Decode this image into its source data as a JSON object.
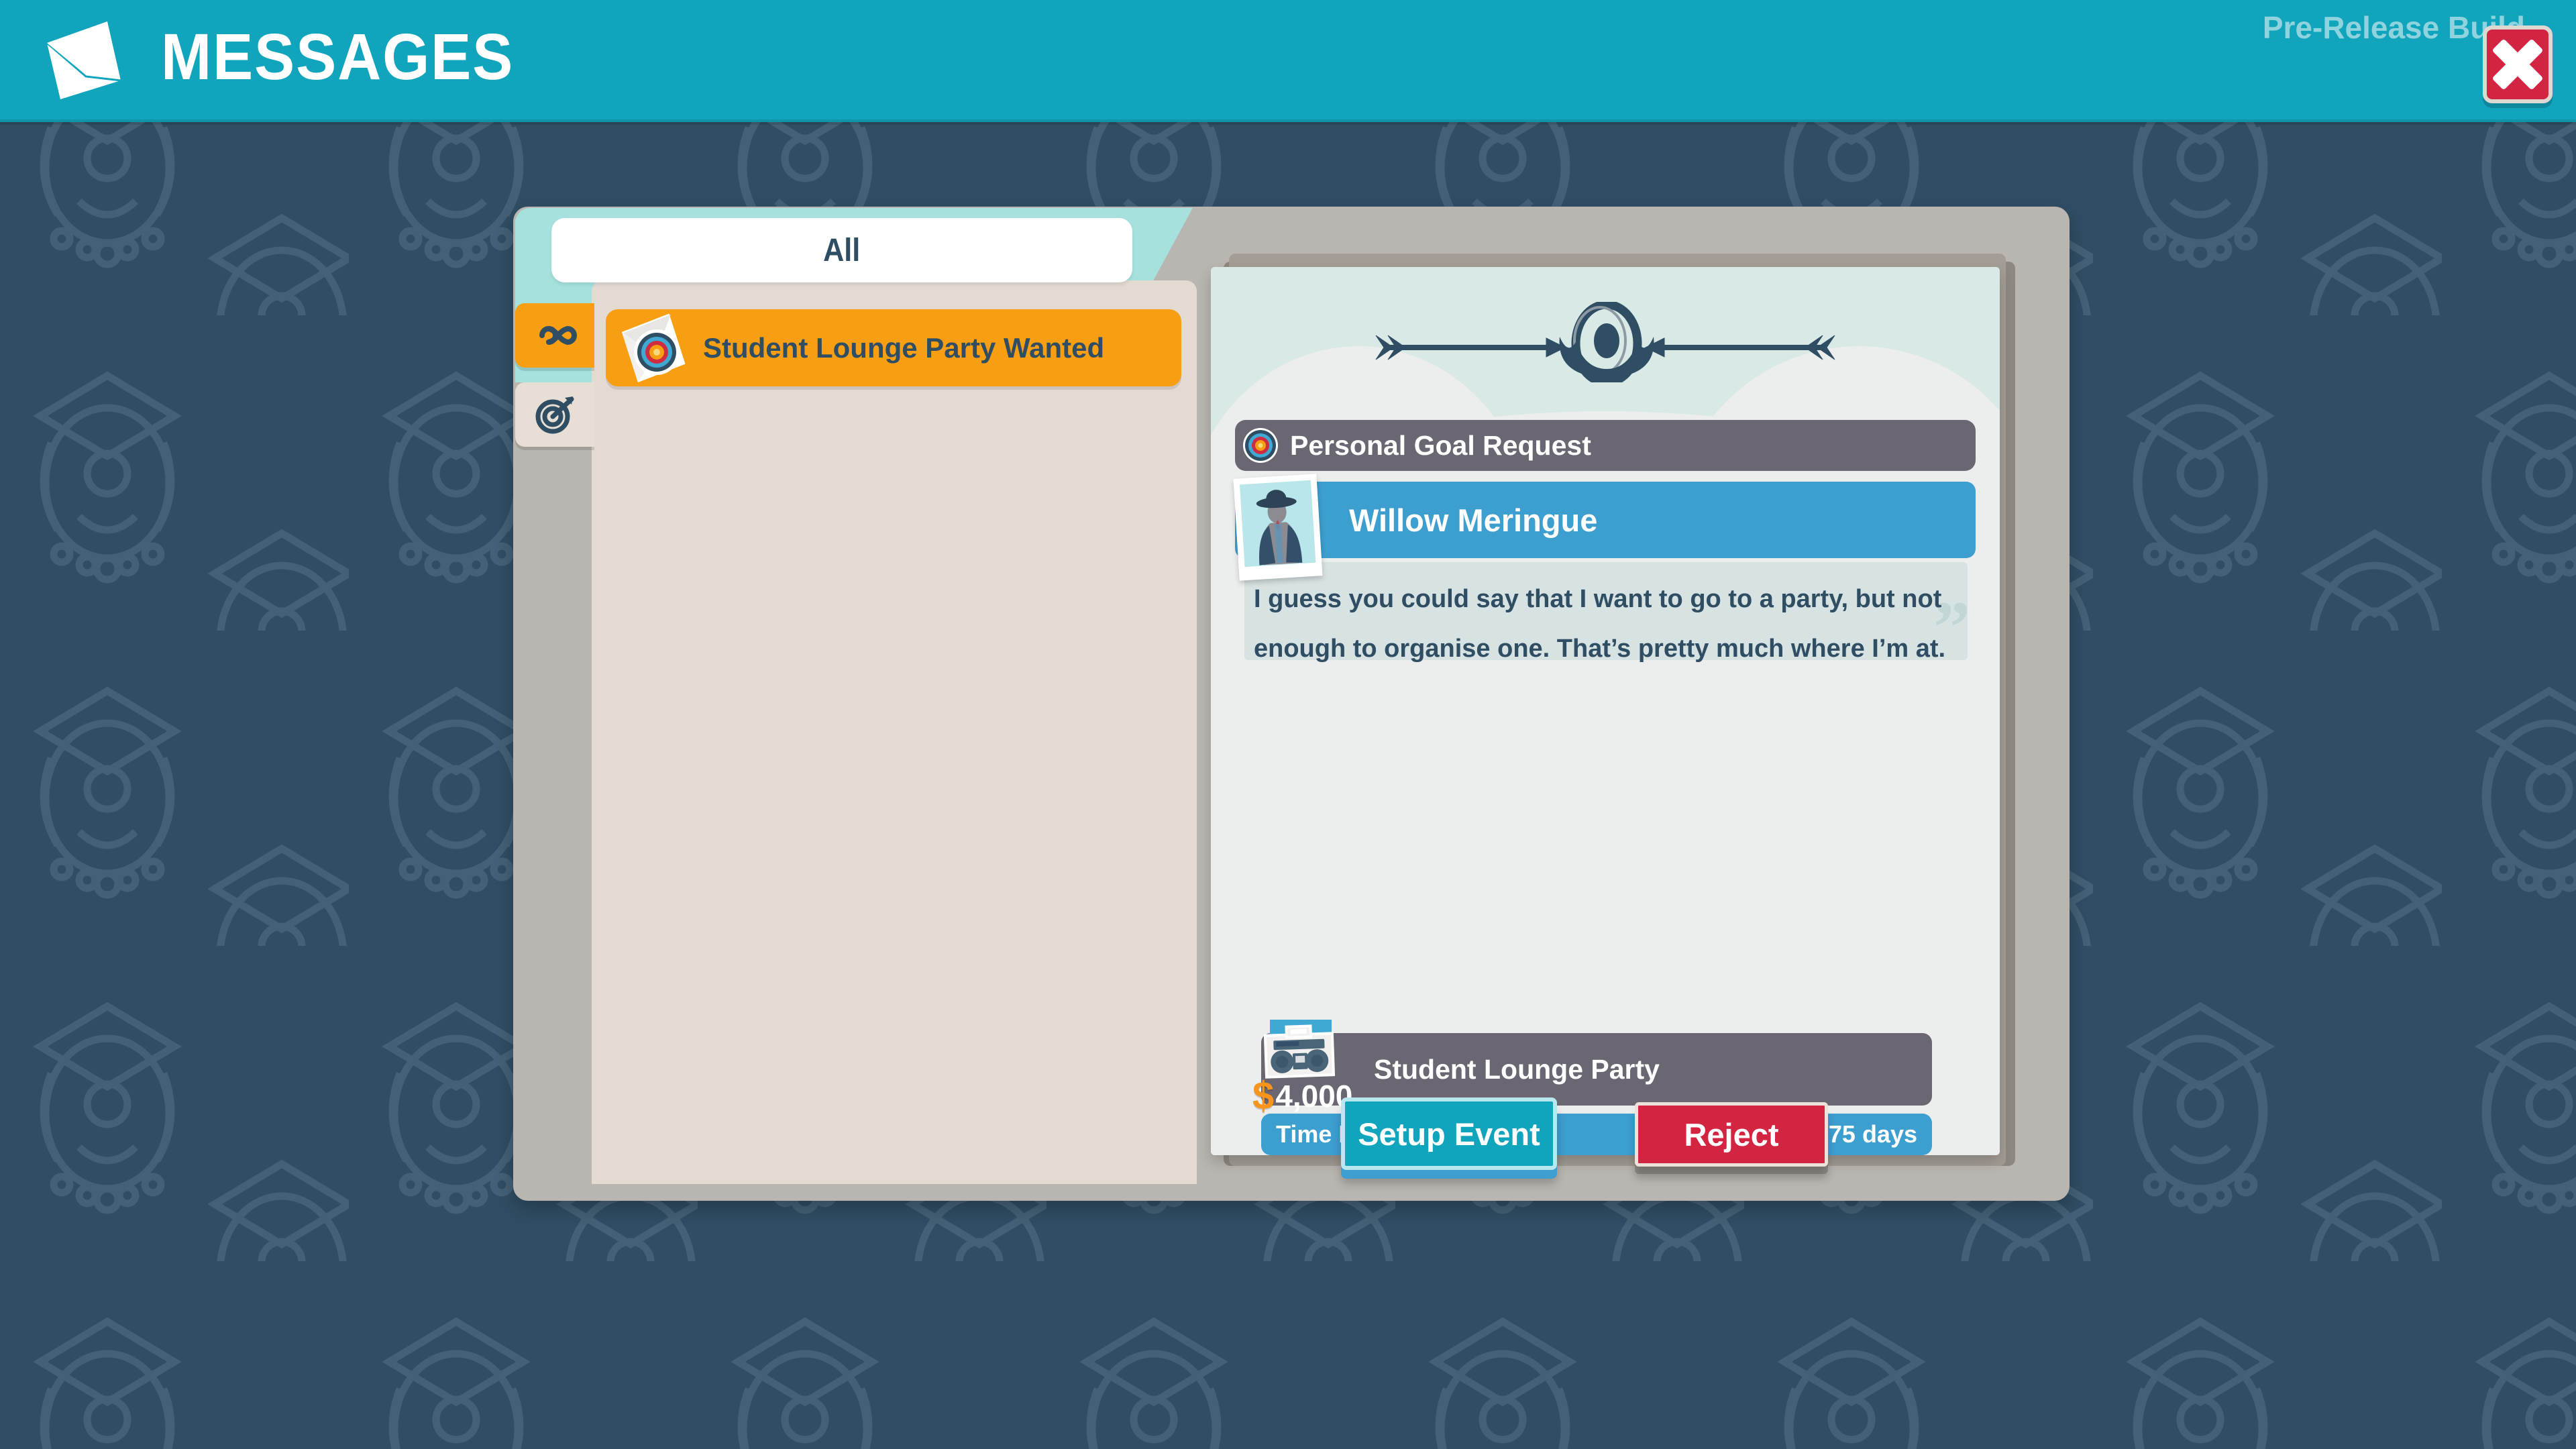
{
  "header": {
    "title": "MESSAGES",
    "envelope_icon": "envelope-icon",
    "prerelease_label": "Pre-Release Build",
    "close_icon": "close-x-icon",
    "bg_color": "#11a5bd"
  },
  "background": {
    "color": "#2f4d63",
    "pattern_icon": "graduation-crest-pattern"
  },
  "sidebar": {
    "tab_label": "All",
    "filters": [
      {
        "name": "all-messages-filter",
        "icon": "infinity-icon",
        "active": true,
        "color": "#f79e12"
      },
      {
        "name": "goal-messages-filter",
        "icon": "target-arrow-icon",
        "active": false,
        "color": "#e7ded5"
      }
    ],
    "messages": [
      {
        "title": "Student Lounge Party Wanted",
        "icon": "envelope-target-icon",
        "selected": true,
        "color": "#f79e12"
      }
    ]
  },
  "letter": {
    "ornament_icon": "arrows-target-ornament",
    "banner": {
      "label": "Personal Goal Request",
      "icon": "bullseye-icon",
      "color": "#6b6772"
    },
    "sender": {
      "name": "Willow Meringue",
      "avatar_icon": "character-portrait-polaroid",
      "bar_color": "#3d9ed0"
    },
    "quote": {
      "open_mark": "“",
      "close_mark": "”",
      "line1": "I guess you could say that I want to go to a party, but not",
      "line2": "enough to organise one. That’s pretty much where I’m at."
    },
    "reward": {
      "name": "Student Lounge Party",
      "icon": "boombox-icon",
      "currency_symbol": "$",
      "cost": "4,000",
      "row_color": "#6b6772"
    },
    "time": {
      "label": "Time Remaining",
      "value": "275 days",
      "bar_color": "#3d9ed0"
    },
    "actions": {
      "accept_label": "Setup Event",
      "accept_color": "#11a5bd",
      "reject_label": "Reject",
      "reject_color": "#d32441"
    }
  }
}
